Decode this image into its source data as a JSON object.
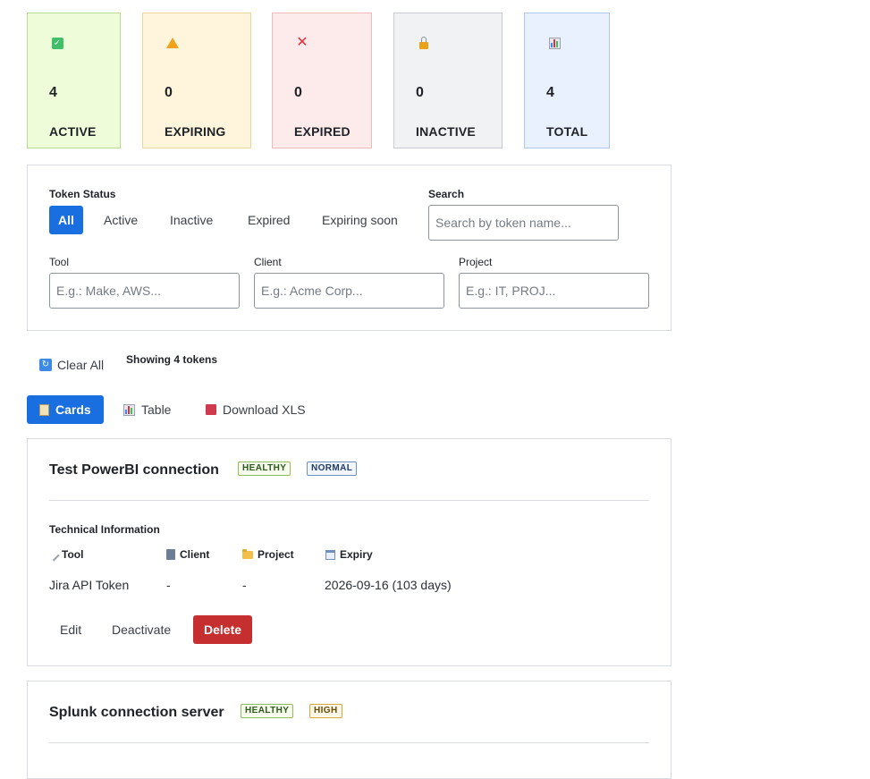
{
  "stats": [
    {
      "icon": "check-icon",
      "value": "4",
      "label": "ACTIVE"
    },
    {
      "icon": "warning-icon",
      "value": "0",
      "label": "EXPIRING"
    },
    {
      "icon": "cross-icon",
      "value": "0",
      "label": "EXPIRED"
    },
    {
      "icon": "lock-icon",
      "value": "0",
      "label": "INACTIVE"
    },
    {
      "icon": "bar-chart-icon",
      "value": "4",
      "label": "TOTAL"
    }
  ],
  "filters": {
    "status_label": "Token Status",
    "status_options": [
      "All",
      "Active",
      "Inactive",
      "Expired",
      "Expiring soon"
    ],
    "selected_status": "All",
    "search_label": "Search",
    "search_placeholder": "Search by token name...",
    "tool_label": "Tool",
    "tool_placeholder": "E.g.: Make, AWS...",
    "client_label": "Client",
    "client_placeholder": "E.g.: Acme Corp...",
    "project_label": "Project",
    "project_placeholder": "E.g.: IT, PROJ..."
  },
  "toolbar": {
    "clear_all": "Clear All",
    "showing": "Showing 4 tokens",
    "view_cards": "Cards",
    "view_table": "Table",
    "download": "Download XLS"
  },
  "colors": {
    "accent": "#1a6fe0",
    "danger": "#c62f2f"
  },
  "cards": [
    {
      "title": "Test PowerBI connection",
      "health": "HEALTHY",
      "priority": "NORMAL",
      "section_title": "Technical Information",
      "headers": {
        "tool": "Tool",
        "client": "Client",
        "project": "Project",
        "expiry": "Expiry"
      },
      "values": {
        "tool": "Jira API Token",
        "client": "-",
        "project": "-",
        "expiry": "2026-09-16 (103 days)"
      },
      "actions": {
        "edit": "Edit",
        "deactivate": "Deactivate",
        "delete": "Delete"
      }
    },
    {
      "title": "Splunk connection server",
      "health": "HEALTHY",
      "priority": "HIGH"
    }
  ]
}
